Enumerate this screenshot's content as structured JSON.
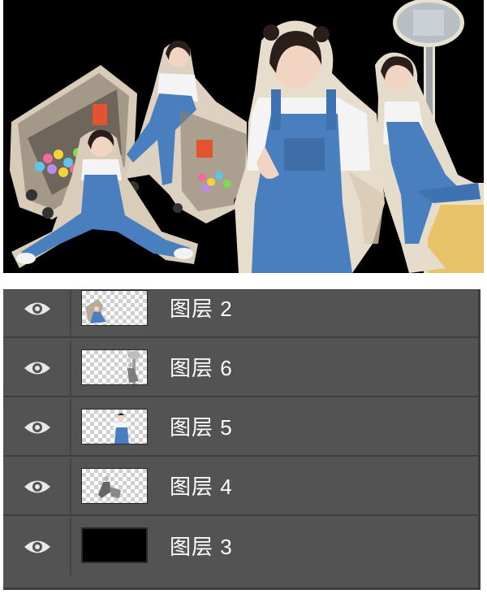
{
  "layers_panel": {
    "layers": [
      {
        "name": "图层 2",
        "visible": true,
        "thumbnail": "seated-girl-with-cart"
      },
      {
        "name": "图层 6",
        "visible": true,
        "thumbnail": "girl-with-sign"
      },
      {
        "name": "图层 5",
        "visible": true,
        "thumbnail": "standing-girl"
      },
      {
        "name": "图层 4",
        "visible": true,
        "thumbnail": "pushing-cart"
      },
      {
        "name": "图层 3",
        "visible": true,
        "thumbnail": "black-fill"
      }
    ]
  },
  "colors": {
    "panel_bg": "#535353",
    "canvas_bg": "#000000",
    "denim": "#4a7fbf",
    "cutout_outline": "#e0d6c6"
  },
  "icons": [
    "eye-icon"
  ]
}
